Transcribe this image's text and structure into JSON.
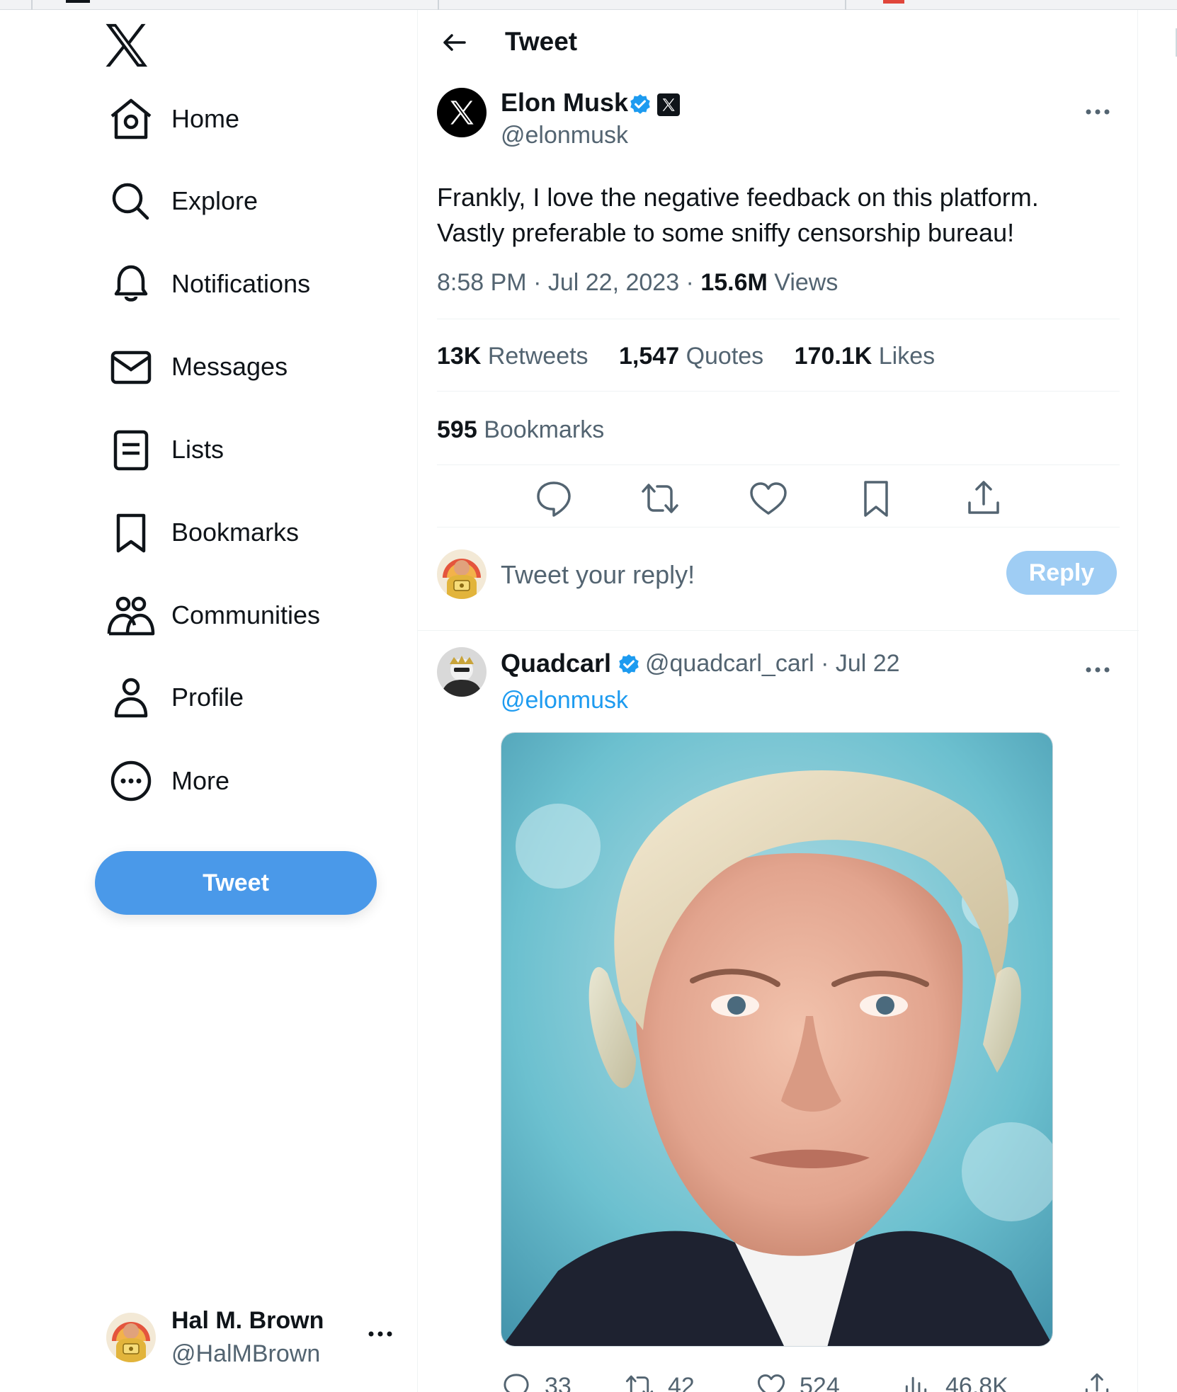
{
  "sidebar": {
    "nav": [
      {
        "label": "Home",
        "icon": "home-icon"
      },
      {
        "label": "Explore",
        "icon": "search-icon"
      },
      {
        "label": "Notifications",
        "icon": "bell-icon"
      },
      {
        "label": "Messages",
        "icon": "envelope-icon"
      },
      {
        "label": "Lists",
        "icon": "list-icon"
      },
      {
        "label": "Bookmarks",
        "icon": "bookmark-icon"
      },
      {
        "label": "Communities",
        "icon": "communities-icon"
      },
      {
        "label": "Profile",
        "icon": "person-icon"
      },
      {
        "label": "More",
        "icon": "more-circle-icon"
      }
    ],
    "tweet_button": "Tweet",
    "account": {
      "name": "Hal M. Brown",
      "handle": "@HalMBrown"
    }
  },
  "header": {
    "title": "Tweet"
  },
  "tweet": {
    "author_name": "Elon Musk",
    "author_handle": "@elonmusk",
    "text_line1": "Frankly, I love the negative feedback on this platform.",
    "text_line2": "Vastly preferable to some sniffy censorship bureau!",
    "time": "8:58 PM",
    "date": "Jul 22, 2023",
    "views_count": "15.6M",
    "views_label": "Views",
    "retweets_count": "13K",
    "retweets_label": "Retweets",
    "quotes_count": "1,547",
    "quotes_label": "Quotes",
    "likes_count": "170.1K",
    "likes_label": "Likes",
    "bookmarks_count": "595",
    "bookmarks_label": "Bookmarks"
  },
  "reply_box": {
    "placeholder": "Tweet your reply!",
    "button": "Reply"
  },
  "reply_tweet": {
    "author_name": "Quadcarl",
    "handle_and_date": "@quadcarl_carl · Jul 22",
    "mention": "@elonmusk",
    "replies": "33",
    "retweets": "42",
    "likes": "524",
    "views": "46.8K"
  },
  "colors": {
    "accent": "#1d9bf0",
    "tweet_button": "#4a99e9",
    "reply_button_disabled": "#9fcdf4",
    "secondary_text": "#536471"
  }
}
